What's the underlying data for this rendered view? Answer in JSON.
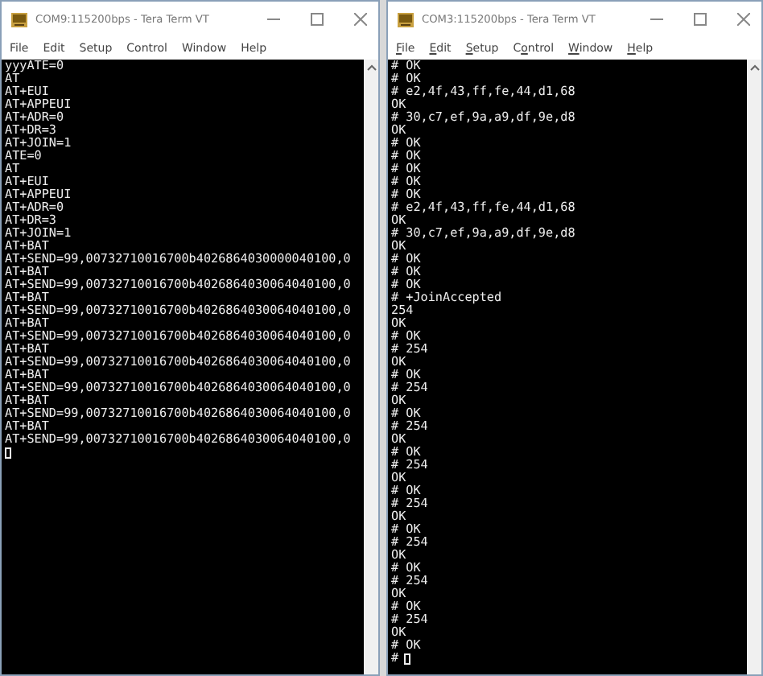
{
  "windows": [
    {
      "title": "COM9:115200bps - Tera Term VT",
      "menu": [
        {
          "kind": "plain",
          "label": "File"
        },
        {
          "kind": "plain",
          "label": "Edit"
        },
        {
          "kind": "plain",
          "label": "Setup"
        },
        {
          "kind": "plain",
          "label": "Control"
        },
        {
          "kind": "plain",
          "label": "Window"
        },
        {
          "kind": "plain",
          "label": "Help"
        }
      ],
      "lines": [
        "yyyATE=0",
        "AT",
        "AT+EUI",
        "AT+APPEUI",
        "AT+ADR=0",
        "AT+DR=3",
        "AT+JOIN=1",
        "ATE=0",
        "AT",
        "AT+EUI",
        "AT+APPEUI",
        "AT+ADR=0",
        "AT+DR=3",
        "AT+JOIN=1",
        "AT+BAT",
        "AT+SEND=99,00732710016700b4026864030000040100,0",
        "AT+BAT",
        "AT+SEND=99,00732710016700b4026864030064040100,0",
        "AT+BAT",
        "AT+SEND=99,00732710016700b4026864030064040100,0",
        "AT+BAT",
        "AT+SEND=99,00732710016700b4026864030064040100,0",
        "AT+BAT",
        "AT+SEND=99,00732710016700b4026864030064040100,0",
        "AT+BAT",
        "AT+SEND=99,00732710016700b4026864030064040100,0",
        "AT+BAT",
        "AT+SEND=99,00732710016700b4026864030064040100,0",
        "AT+BAT",
        "AT+SEND=99,00732710016700b4026864030064040100,0"
      ],
      "cursor_visible": true
    },
    {
      "title": "COM3:115200bps - Tera Term VT",
      "menu": [
        {
          "kind": "mnemonic",
          "key": "F",
          "suffix": "ile"
        },
        {
          "kind": "mnemonic",
          "key": "E",
          "suffix": "dit"
        },
        {
          "kind": "mnemonic",
          "key": "S",
          "suffix": "etup"
        },
        {
          "kind": "mnemonic",
          "prefix": "C",
          "key": "o",
          "suffix": "ntrol"
        },
        {
          "kind": "mnemonic",
          "key": "W",
          "suffix": "indow"
        },
        {
          "kind": "mnemonic",
          "key": "H",
          "suffix": "elp"
        }
      ],
      "lines": [
        "# OK",
        "# OK",
        "# e2,4f,43,ff,fe,44,d1,68",
        "OK",
        "# 30,c7,ef,9a,a9,df,9e,d8",
        "OK",
        "# OK",
        "# OK",
        "# OK",
        "# OK",
        "# OK",
        "# e2,4f,43,ff,fe,44,d1,68",
        "OK",
        "# 30,c7,ef,9a,a9,df,9e,d8",
        "OK",
        "# OK",
        "# OK",
        "# OK",
        "# +JoinAccepted",
        "254",
        "OK",
        "# OK",
        "# 254",
        "OK",
        "# OK",
        "# 254",
        "OK",
        "# OK",
        "# 254",
        "OK",
        "# OK",
        "# 254",
        "OK",
        "# OK",
        "# 254",
        "OK",
        "# OK",
        "# 254",
        "OK",
        "# OK",
        "# 254",
        "OK",
        "# OK",
        "# 254",
        "OK",
        "# OK"
      ],
      "cursor_visible": true,
      "cursor_prompt": "#"
    }
  ]
}
